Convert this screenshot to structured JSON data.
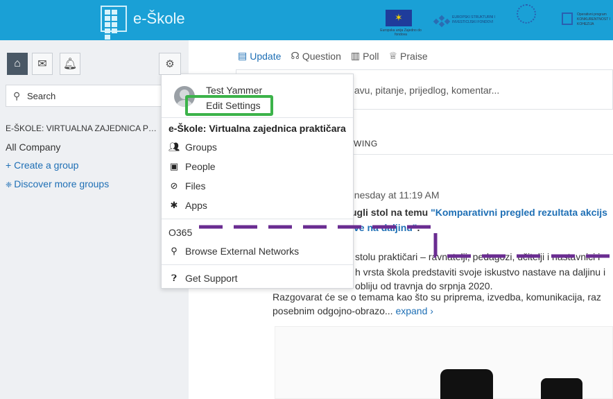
{
  "header": {
    "app_name": "e-Škole",
    "eu_caption": "Europska unija Zajedno do fondova",
    "esf_caption": "EUROPSKI STRUKTURNI I INVESTICIJSKI FONDOVI",
    "op_caption": "Operativni program KONKURENTNOST I KOHEZIJA"
  },
  "sidebar": {
    "search_label": "Search",
    "group_title": "E-ŠKOLE: VIRTUALNA ZAJEDNICA PRAK...",
    "links": {
      "all_company": "All Company",
      "create_group": "Create a group",
      "discover_groups": "Discover more groups"
    }
  },
  "compose": {
    "tabs": [
      "Update",
      "Question",
      "Poll",
      "Praise"
    ],
    "placeholder": "ojavu, pitanje, prijedlog, komentar..."
  },
  "feed": {
    "following_label": "WING",
    "post_time": "dnesday at 11:19 AM",
    "line1_prefix": "ugli stol na temu",
    "line1_link": "\"Komparativni pregled rezultata akcijs",
    "line2_link": "ve na daljinu\"",
    "line2_end": ".",
    "line3_a": "stolu praktičari – ravnatelji, pedagozi, učitelji i nastavnici i",
    "line4": "h vrsta škola predstaviti svoje iskustvo nastave na daljinu i",
    "line5": "obliju od travnja do srpnja 2020.",
    "line6": "Razgovarat će se o temama kao što su priprema, izvedba, komunikacija, raz",
    "line7_text": "posebnim odgojno-obrazo...",
    "expand": "expand ›"
  },
  "menu": {
    "user_name": "Test Yammer",
    "edit_settings": "Edit Settings",
    "network_name": "e-Škole: Virtualna zajednica praktičara",
    "items": [
      "Groups",
      "People",
      "Files",
      "Apps"
    ],
    "o365": "O365",
    "browse_external": "Browse External Networks",
    "get_support": "Get Support"
  },
  "colors": {
    "header_bg": "#1aa0d6",
    "highlight_green": "#3cb34a",
    "annotation_purple": "#6a2c91",
    "link_blue": "#1e6fb5"
  }
}
